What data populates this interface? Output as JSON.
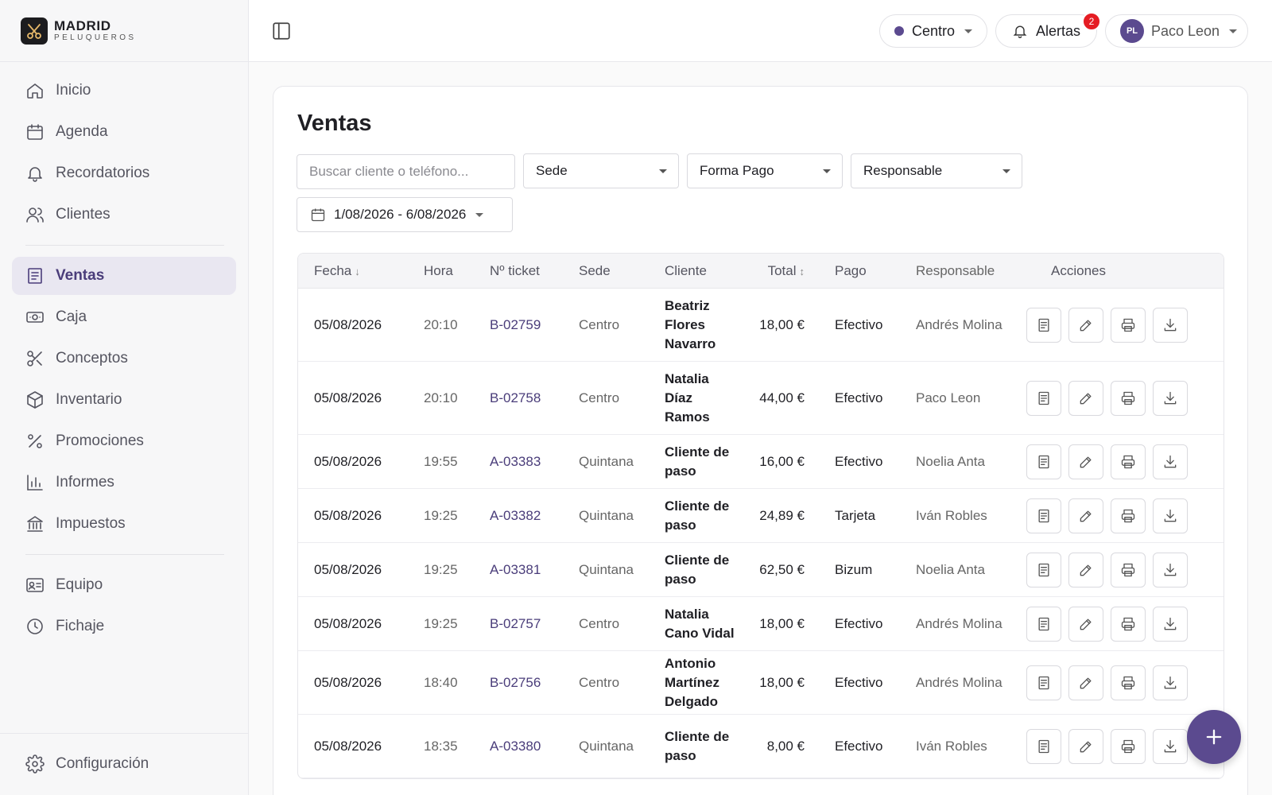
{
  "brand": {
    "name": "MADRID",
    "sub": "PELUQUEROS"
  },
  "nav": {
    "items": [
      {
        "key": "inicio",
        "label": "Inicio",
        "icon": "home-icon"
      },
      {
        "key": "agenda",
        "label": "Agenda",
        "icon": "calendar-icon"
      },
      {
        "key": "recordatorios",
        "label": "Recordatorios",
        "icon": "bell-icon"
      },
      {
        "key": "clientes",
        "label": "Clientes",
        "icon": "users-icon"
      },
      {
        "key": "ventas",
        "label": "Ventas",
        "icon": "receipt-icon",
        "active": true
      },
      {
        "key": "caja",
        "label": "Caja",
        "icon": "cash-icon"
      },
      {
        "key": "conceptos",
        "label": "Conceptos",
        "icon": "scissors-icon"
      },
      {
        "key": "inventario",
        "label": "Inventario",
        "icon": "box-icon"
      },
      {
        "key": "promociones",
        "label": "Promociones",
        "icon": "percent-icon"
      },
      {
        "key": "informes",
        "label": "Informes",
        "icon": "bar-chart-icon"
      },
      {
        "key": "impuestos",
        "label": "Impuestos",
        "icon": "bank-icon"
      },
      {
        "key": "equipo",
        "label": "Equipo",
        "icon": "id-card-icon"
      },
      {
        "key": "fichaje",
        "label": "Fichaje",
        "icon": "clock-icon"
      }
    ],
    "config_label": "Configuración"
  },
  "topbar": {
    "location": "Centro",
    "alerts_label": "Alertas",
    "alerts_count": "2",
    "user_initials": "PL",
    "user_name": "Paco Leon"
  },
  "page": {
    "title": "Ventas",
    "search_placeholder": "Buscar cliente o teléfono...",
    "filter_sede": "Sede",
    "filter_pago": "Forma Pago",
    "filter_resp": "Responsable",
    "date_range": "1/08/2026 - 6/08/2026"
  },
  "table": {
    "headers": {
      "fecha": "Fecha",
      "hora": "Hora",
      "ticket": "Nº ticket",
      "sede": "Sede",
      "cliente": "Cliente",
      "total": "Total",
      "pago": "Pago",
      "responsable": "Responsable",
      "acciones": "Acciones"
    },
    "rows": [
      {
        "fecha": "05/08/2026",
        "hora": "20:10",
        "ticket": "B-02759",
        "sede": "Centro",
        "cliente": "Beatriz Flores Navarro",
        "total": "18,00 €",
        "pago": "Efectivo",
        "responsable": "Andrés Molina"
      },
      {
        "fecha": "05/08/2026",
        "hora": "20:10",
        "ticket": "B-02758",
        "sede": "Centro",
        "cliente": "Natalia Díaz Ramos",
        "total": "44,00 €",
        "pago": "Efectivo",
        "responsable": "Paco Leon"
      },
      {
        "fecha": "05/08/2026",
        "hora": "19:55",
        "ticket": "A-03383",
        "sede": "Quintana",
        "cliente": "Cliente de paso",
        "total": "16,00 €",
        "pago": "Efectivo",
        "responsable": "Noelia Anta"
      },
      {
        "fecha": "05/08/2026",
        "hora": "19:25",
        "ticket": "A-03382",
        "sede": "Quintana",
        "cliente": "Cliente de paso",
        "total": "24,89 €",
        "pago": "Tarjeta",
        "responsable": "Iván Robles"
      },
      {
        "fecha": "05/08/2026",
        "hora": "19:25",
        "ticket": "A-03381",
        "sede": "Quintana",
        "cliente": "Cliente de paso",
        "total": "62,50 €",
        "pago": "Bizum",
        "responsable": "Noelia Anta"
      },
      {
        "fecha": "05/08/2026",
        "hora": "19:25",
        "ticket": "B-02757",
        "sede": "Centro",
        "cliente": "Natalia Cano Vidal",
        "total": "18,00 €",
        "pago": "Efectivo",
        "responsable": "Andrés Molina"
      },
      {
        "fecha": "05/08/2026",
        "hora": "18:40",
        "ticket": "B-02756",
        "sede": "Centro",
        "cliente": "Antonio Martínez Delgado",
        "total": "18,00 €",
        "pago": "Efectivo",
        "responsable": "Andrés Molina"
      },
      {
        "fecha": "05/08/2026",
        "hora": "18:35",
        "ticket": "A-03380",
        "sede": "Quintana",
        "cliente": "Cliente de paso",
        "total": "8,00 €",
        "pago": "Efectivo",
        "responsable": "Iván Robles"
      }
    ]
  },
  "colors": {
    "accent": "#5b4a8f",
    "alert": "#e51c23",
    "active_bg": "#e9e7f1"
  }
}
